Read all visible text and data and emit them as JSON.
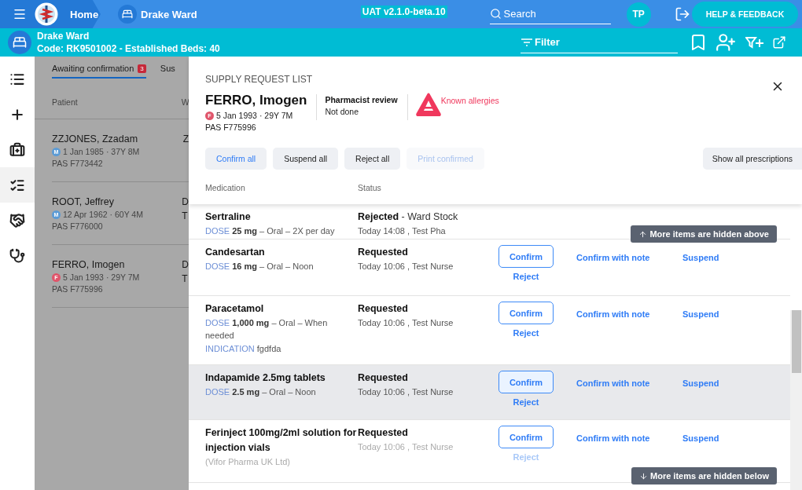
{
  "top_bar": {
    "home": "Home",
    "ward": "Drake Ward",
    "version": "UAT v2.1.0-beta.10",
    "search": {
      "placeholder": "Search"
    },
    "avatar": "TP",
    "help": "HELP & FEEDBACK"
  },
  "ward_bar": {
    "title": "Drake Ward",
    "subtitle": "Code: RK9501002 - Established Beds: 40",
    "filter": {
      "placeholder": "Filter"
    }
  },
  "sidebar": {
    "items": [
      {
        "selected": false
      },
      {
        "selected": false
      },
      {
        "selected": false
      },
      {
        "selected": true
      },
      {
        "selected": false
      },
      {
        "selected": false
      }
    ]
  },
  "patient_list": {
    "tabs": [
      {
        "label": "Awaiting confirmation",
        "count": "3",
        "selected": true
      },
      {
        "label": "Sus",
        "selected": false
      }
    ],
    "columns": [
      "Patient",
      "W"
    ],
    "rows": [
      {
        "name": "ZZJONES, Zzadam",
        "sex": "M",
        "color": "#5b9bd5",
        "dob": "1 Jan 1985 · 37Y 8M",
        "pas": "PAS F773442",
        "column_2": [
          "Z"
        ]
      },
      {
        "name": "ROOT, Jeffrey",
        "sex": "M",
        "color": "#5b9bd5",
        "dob": "12 Apr 1962 · 60Y 4M",
        "pas": "PAS F776000",
        "column_2": [
          "D",
          "T"
        ]
      },
      {
        "name": "FERRO, Imogen",
        "sex": "F",
        "color": "#e0556b",
        "dob": "5 Jan 1993 · 29Y 7M",
        "pas": "PAS F775996",
        "column_2": [
          "D",
          "T"
        ]
      }
    ]
  },
  "dialog": {
    "title": "SUPPLY REQUEST LIST",
    "patient": {
      "name": "FERRO, Imogen",
      "sex": "F",
      "color": "#e0556b",
      "dob": "5 Jan 1993 · 29Y 7M",
      "pas": "PAS F775996"
    },
    "review": {
      "label": "Pharmacist review",
      "value": "Not done"
    },
    "allergy": "Known allergies",
    "buttons": [
      {
        "label": "Confirm all",
        "kind": "primary",
        "disabled": false
      },
      {
        "label": "Suspend all",
        "kind": "plain",
        "disabled": false
      },
      {
        "label": "Reject all",
        "kind": "plain",
        "disabled": false
      },
      {
        "label": "Print confirmed",
        "kind": "plain",
        "disabled": true
      }
    ],
    "show_all": "Show all prescriptions",
    "columns": [
      "Medication",
      "Status"
    ],
    "hidden_above": "More items are hidden above",
    "hidden_below": "More items are hidden below",
    "rows": [
      {
        "name": "Sertraline",
        "dose_label": "DOSE",
        "dose": "25 mg",
        "route": " – Oral – 2X per day",
        "status": "Rejected",
        "status_note": " - Ward Stock",
        "time": "Today 14:08 , Test Pha",
        "selected": false,
        "faded": false
      },
      {
        "name": "Candesartan",
        "dose_label": "DOSE",
        "dose": "16 mg",
        "route": " – Oral – Noon",
        "status": "Requested",
        "time": "Today 10:06 , Test Nurse",
        "actions": {
          "confirm": "Confirm",
          "reject": "Reject",
          "confirm_note": "Confirm with note",
          "suspend": "Suspend"
        },
        "selected": false,
        "faded": false
      },
      {
        "name": "Paracetamol",
        "dose_label": "DOSE",
        "dose": "1,000 mg",
        "route": " – Oral – When needed",
        "indication_label": "INDICATION",
        "indication": "fgdfda",
        "status": "Requested",
        "time": "Today 10:06 , Test Nurse",
        "actions": {
          "confirm": "Confirm",
          "reject": "Reject",
          "confirm_note": "Confirm with note",
          "suspend": "Suspend"
        },
        "selected": false,
        "faded": false
      },
      {
        "name": "Indapamide 2.5mg tablets",
        "dose_label": "DOSE",
        "dose": "2.5 mg",
        "route": " – Oral – Noon",
        "status": "Requested",
        "time": "Today 10:06 , Test Nurse",
        "actions": {
          "confirm": "Confirm",
          "reject": "Reject",
          "confirm_note": "Confirm with note",
          "suspend": "Suspend"
        },
        "selected": true,
        "faded": false
      },
      {
        "name": "Ferinject 100mg/2ml solution for injection vials",
        "maker": "(Vifor Pharma UK Ltd)",
        "status": "Requested",
        "time": "Today 10:06 , Test Nurse",
        "actions": {
          "confirm": "Confirm",
          "reject": "Reject",
          "confirm_note": "Confirm with note",
          "suspend": "Suspend"
        },
        "selected": false,
        "faded": true
      }
    ]
  }
}
